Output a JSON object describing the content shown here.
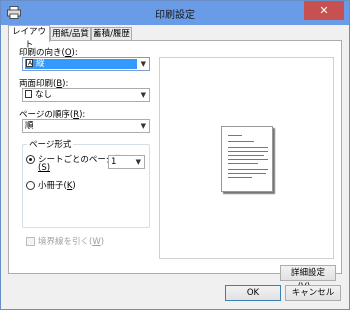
{
  "window": {
    "title": "印刷設定",
    "close_glyph": "✕"
  },
  "tabs": [
    {
      "label": "レイアウト",
      "active": true
    },
    {
      "label": "用紙/品質",
      "active": false
    },
    {
      "label": "蓄積/履歴",
      "active": false
    }
  ],
  "layout": {
    "orientation": {
      "label": "印刷の向き(",
      "key": "O",
      "suffix": "):",
      "value": "縦",
      "icon": "portrait-icon"
    },
    "duplex": {
      "label": "両面印刷(",
      "key": "B",
      "suffix": "):",
      "value": "なし",
      "icon": "page-icon"
    },
    "page_order": {
      "label": "ページの順序(",
      "key": "R",
      "suffix": "):",
      "value": "順"
    },
    "page_format": {
      "group_label": "ページ形式",
      "pages_per_sheet": {
        "label": "シートごとのページ数",
        "key_line": "(S)",
        "selected": true,
        "value": "1"
      },
      "booklet": {
        "label": "小冊子(",
        "key": "K",
        "suffix": ")",
        "selected": false
      }
    },
    "border": {
      "label": "境界線を引く(",
      "key": "W",
      "suffix": ")",
      "checked": false,
      "enabled": false
    }
  },
  "buttons": {
    "advanced": "詳細設定(V)...",
    "ok": "OK",
    "cancel": "キャンセル"
  }
}
